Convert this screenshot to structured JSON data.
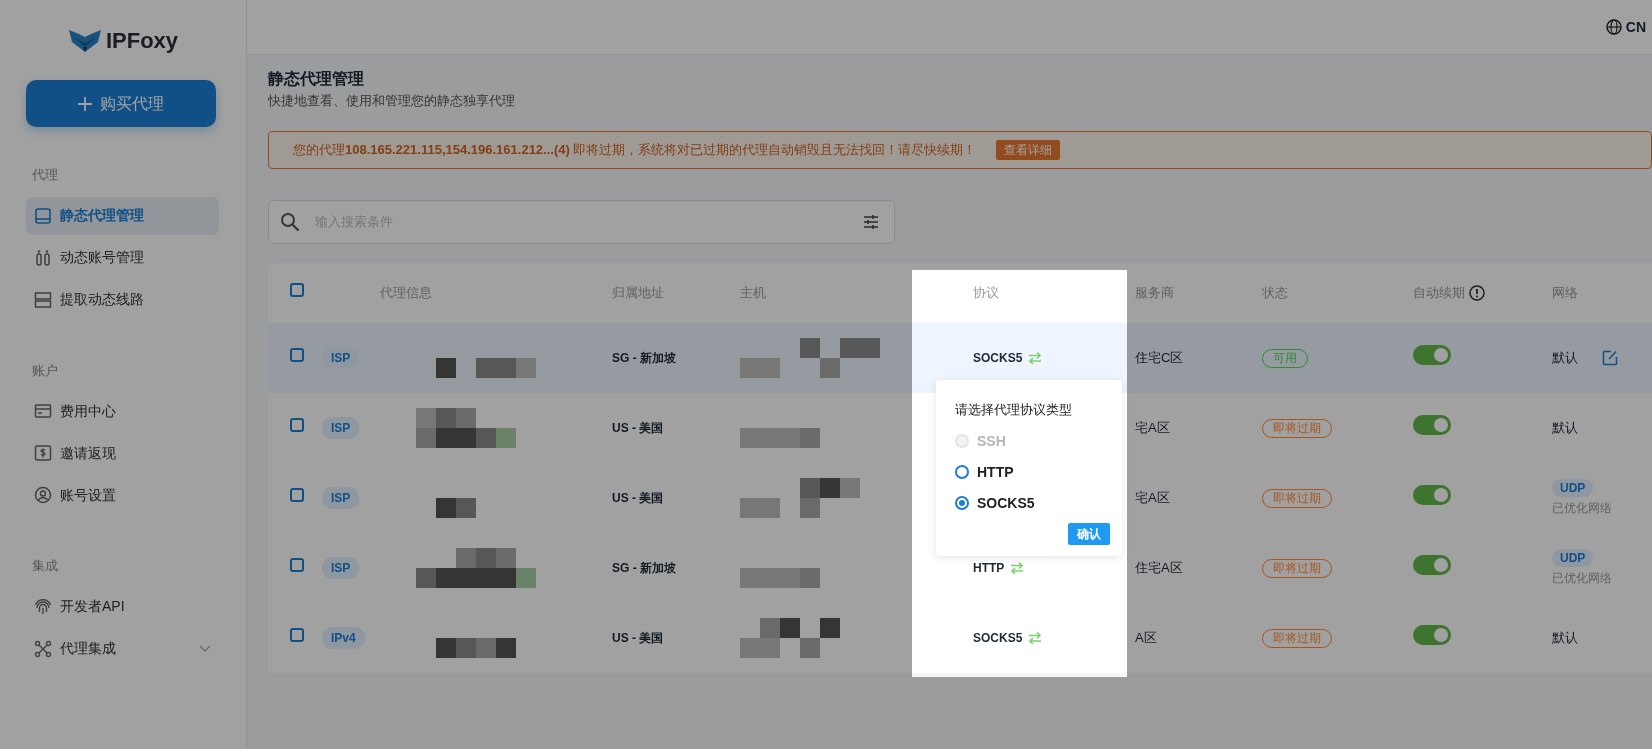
{
  "sidebar": {
    "logo": "IPFoxy",
    "buy_button": "购买代理",
    "sections": [
      {
        "title": "代理",
        "items": [
          {
            "label": "静态代理管理",
            "selected": true
          },
          {
            "label": "动态账号管理",
            "selected": false
          },
          {
            "label": "提取动态线路",
            "selected": false
          }
        ]
      },
      {
        "title": "账户",
        "items": [
          {
            "label": "费用中心",
            "selected": false
          },
          {
            "label": "邀请返现",
            "selected": false
          },
          {
            "label": "账号设置",
            "selected": false
          }
        ]
      },
      {
        "title": "集成",
        "items": [
          {
            "label": "开发者API",
            "selected": false
          },
          {
            "label": "代理集成",
            "selected": false,
            "expanded": false
          }
        ]
      }
    ]
  },
  "top_bar": {
    "language": "CN"
  },
  "page": {
    "title": "静态代理管理",
    "subtitle": "快捷地查看、使用和管理您的静态独享代理"
  },
  "alert": {
    "text": "您的代理**108.165.221.115,154.196.161.212...(4)** 即将过期，系统将对已过期的代理自动销毁且无法找回！请尽快续期！",
    "button": "查看详细"
  },
  "search": {
    "placeholder": "输入搜索条件"
  },
  "table": {
    "all_checked": false,
    "columns": [
      "代理信息",
      "归属地址",
      "主机",
      "协议",
      "服务商",
      "状态",
      "自动续期",
      "网络"
    ],
    "rows": [
      {
        "checked": false,
        "highlighted": true,
        "type": "ISP",
        "location": "SG - 新加坡",
        "protocol": "SOCKS5",
        "provider": "住宅C区",
        "status": {
          "label": "可用",
          "color": "#2e8b34"
        },
        "auto_renew": true,
        "network": {
          "kind": "default",
          "label": "默认",
          "editable": true
        }
      },
      {
        "checked": false,
        "highlighted": false,
        "type": "ISP",
        "location": "US - 美国",
        "provider": "宅A区",
        "status": {
          "label": "即将过期",
          "color": "#a5561f"
        },
        "auto_renew": true,
        "network": {
          "kind": "default",
          "label": "默认",
          "editable": false
        }
      },
      {
        "checked": false,
        "highlighted": false,
        "type": "ISP",
        "location": "US - 美国",
        "provider": "宅A区",
        "status": {
          "label": "即将过期",
          "color": "#a5561f"
        },
        "auto_renew": true,
        "network": {
          "kind": "udp",
          "badge": "UDP",
          "note": "已优化网络"
        }
      },
      {
        "checked": false,
        "highlighted": false,
        "type": "ISP",
        "location": "SG - 新加坡",
        "protocol": "HTTP",
        "provider": "住宅A区",
        "status": {
          "label": "即将过期",
          "color": "#a5561f"
        },
        "auto_renew": true,
        "network": {
          "kind": "udp",
          "badge": "UDP",
          "note": "已优化网络"
        }
      },
      {
        "checked": false,
        "highlighted": false,
        "type": "IPv4",
        "location": "US - 美国",
        "protocol": "SOCKS5",
        "provider": "A区",
        "status": {
          "label": "即将过期",
          "color": "#a5561f"
        },
        "auto_renew": true,
        "network": {
          "kind": "default",
          "label": "默认",
          "editable": false
        }
      }
    ]
  },
  "protocol_popover": {
    "title": "请选择代理协议类型",
    "options": [
      {
        "label": "SSH",
        "disabled": true,
        "selected": false
      },
      {
        "label": "HTTP",
        "disabled": false,
        "selected": false
      },
      {
        "label": "SOCKS5",
        "disabled": false,
        "selected": true
      }
    ],
    "confirm": "确认"
  }
}
